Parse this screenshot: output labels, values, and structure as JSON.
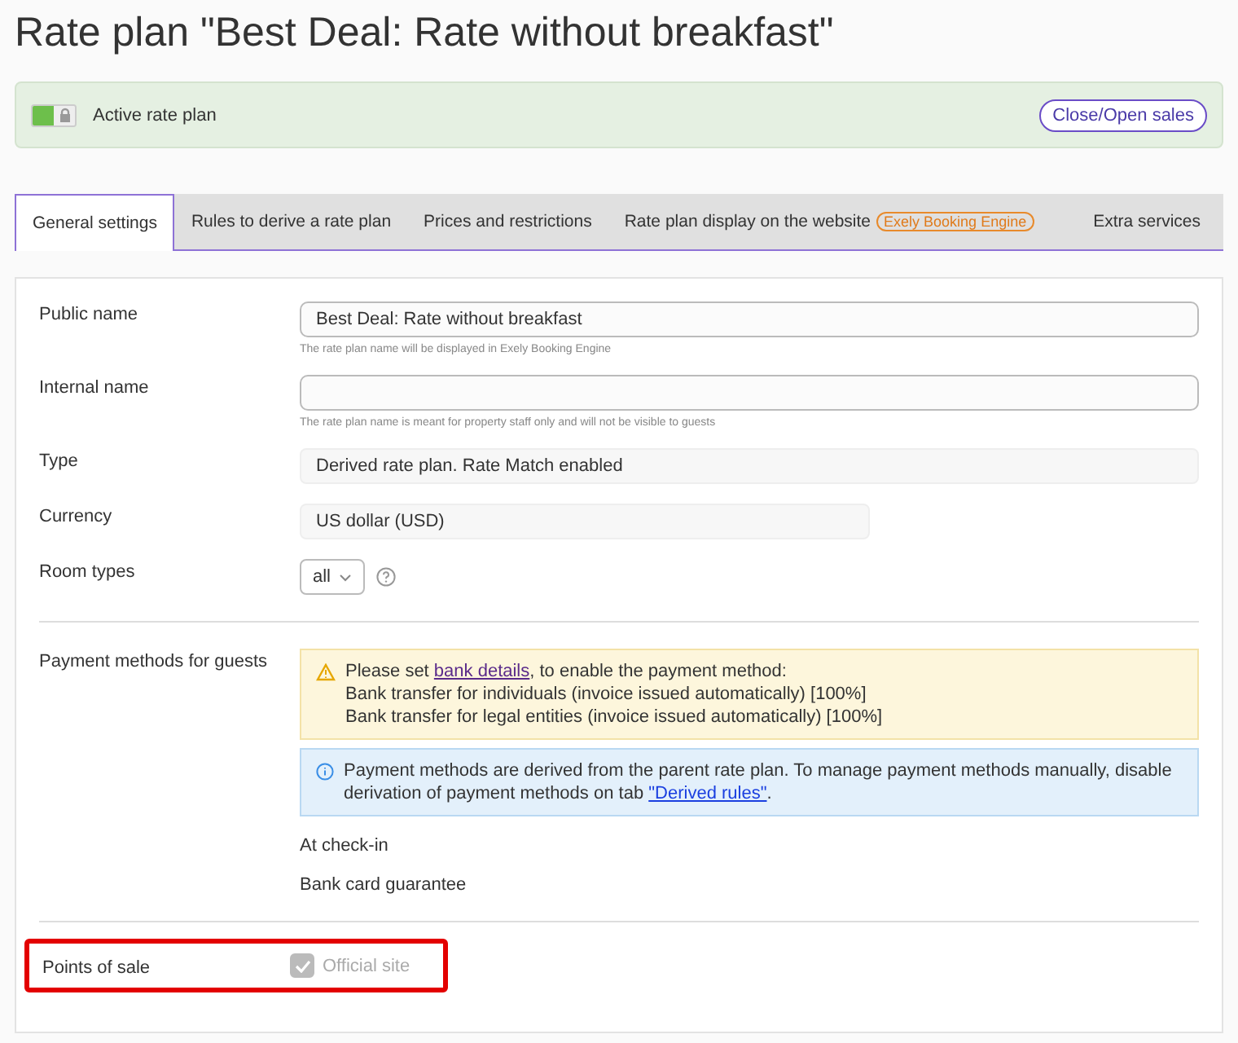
{
  "title": "Rate plan \"Best Deal: Rate without breakfast\"",
  "status": {
    "label": "Active rate plan",
    "active": true,
    "locked": true,
    "button": "Close/Open sales"
  },
  "tabs": [
    {
      "label": "General settings",
      "selected": true
    },
    {
      "label": "Rules to derive a rate plan",
      "selected": false
    },
    {
      "label": "Prices and restrictions",
      "selected": false
    },
    {
      "label": "Rate plan display on the website",
      "badge": "Exely Booking Engine",
      "selected": false
    },
    {
      "label": "Extra services",
      "selected": false
    }
  ],
  "fields": [
    {
      "label": "Public name",
      "kind": "input",
      "value": "Best Deal: Rate without breakfast",
      "hint": "The rate plan name will be displayed in Exely Booking Engine"
    },
    {
      "label": "Internal name",
      "kind": "input",
      "hint": "The rate plan name is meant for property staff only and will not be visible to guests"
    },
    {
      "label": "Type",
      "kind": "readonly",
      "value": "Derived rate plan. Rate Match enabled"
    },
    {
      "label": "Currency",
      "kind": "readonly-short",
      "value": "US dollar (USD)"
    },
    {
      "label": "Room types",
      "kind": "select",
      "value": "all"
    }
  ],
  "payment": {
    "label": "Payment methods for guests",
    "warning": {
      "before": "Please set ",
      "link": "bank details",
      "after": ", to enable the payment method:",
      "lines": [
        "Bank transfer for individuals (invoice issued automatically) [100%]",
        "Bank transfer for legal entities (invoice issued automatically) [100%]"
      ]
    },
    "info": {
      "before": "Payment methods are derived from the parent rate plan. To manage payment methods manually, disable derivation of payment methods on tab ",
      "link": "\"Derived rules\"",
      "after": "."
    },
    "methods": [
      "At check-in",
      "Bank card guarantee"
    ]
  },
  "points_of_sale": {
    "label": "Points of sale",
    "highlighted": true,
    "options": [
      {
        "label": "Official site",
        "checked": true,
        "disabled": true
      }
    ]
  }
}
